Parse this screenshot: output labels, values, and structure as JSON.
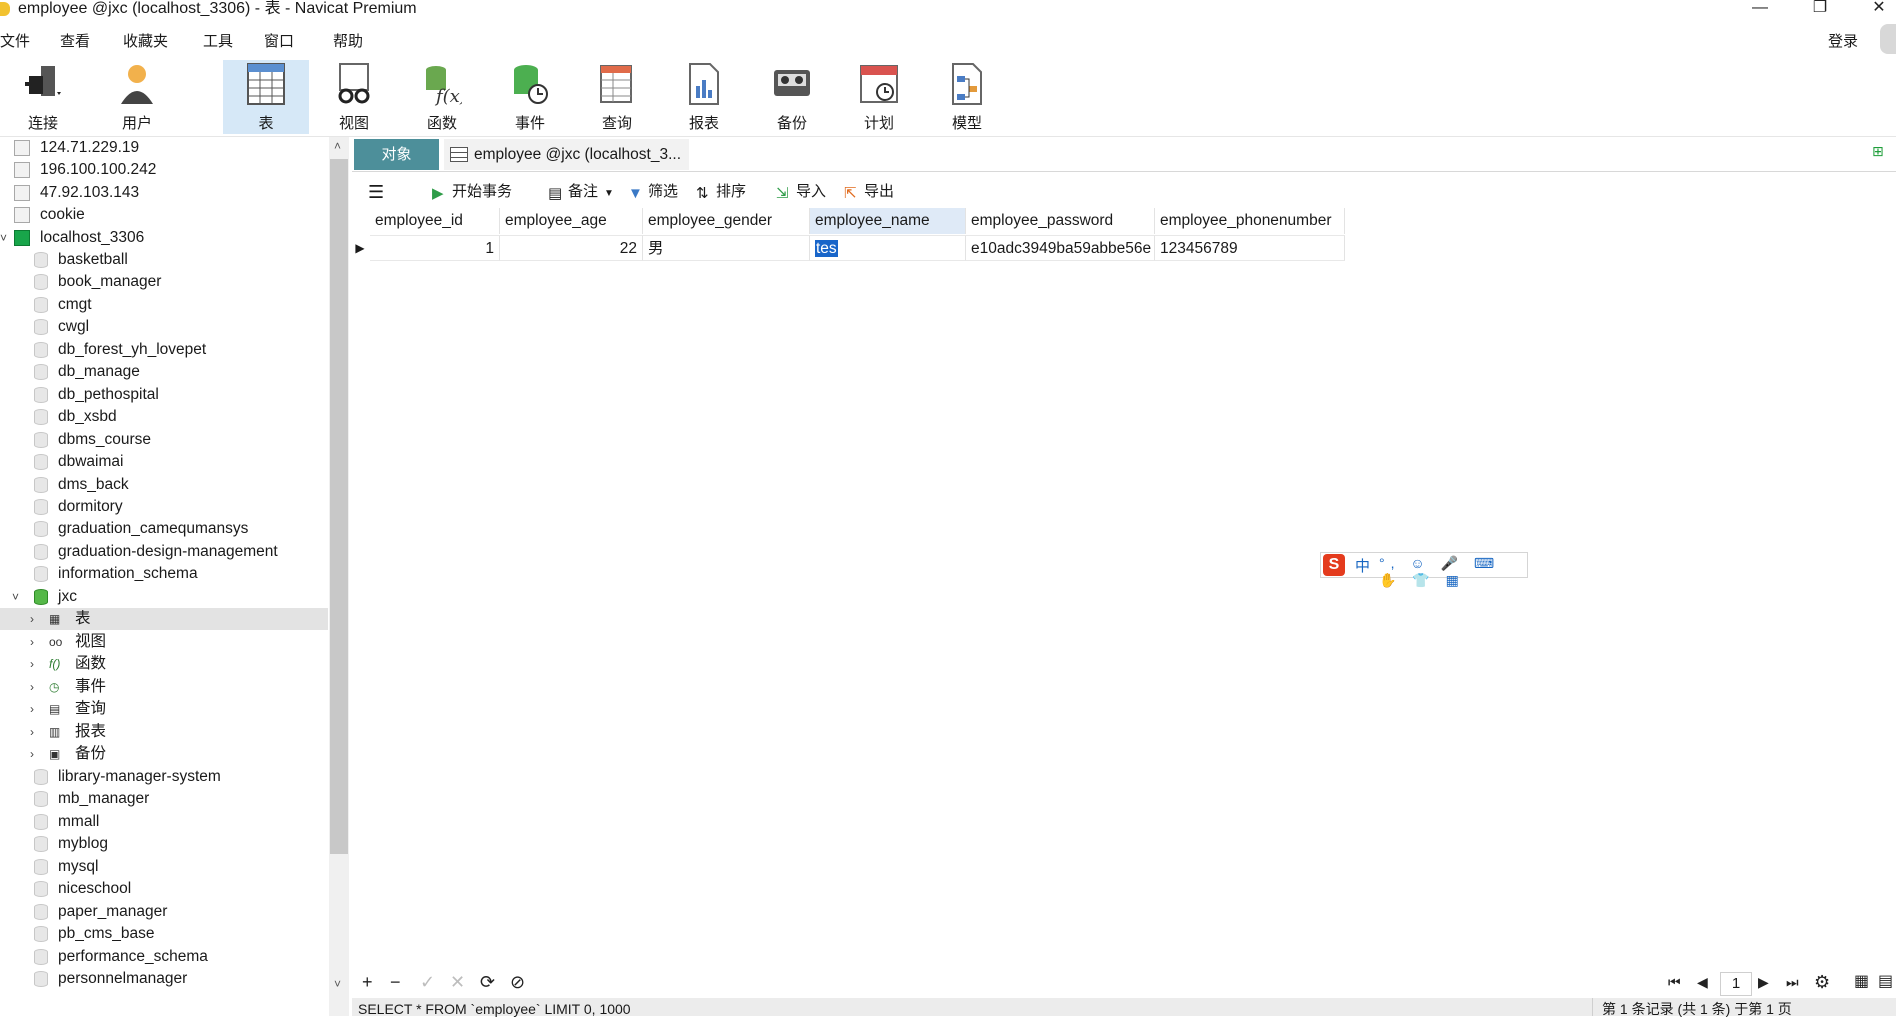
{
  "window": {
    "title": "employee @jxc (localhost_3306) - 表 - Navicat Premium",
    "minimize": "—",
    "restore": "❐",
    "close": "✕"
  },
  "menu": [
    "文件",
    "查看",
    "收藏夹",
    "工具",
    "窗口",
    "帮助"
  ],
  "login_label": "登录",
  "toolbar": [
    {
      "label": "连接",
      "icon": "plug-icon"
    },
    {
      "label": "用户",
      "icon": "user-icon"
    },
    {
      "label": "表",
      "icon": "table-icon",
      "active": true
    },
    {
      "label": "视图",
      "icon": "view-glasses-icon"
    },
    {
      "label": "函数",
      "icon": "function-icon"
    },
    {
      "label": "事件",
      "icon": "event-clock-icon"
    },
    {
      "label": "查询",
      "icon": "query-icon"
    },
    {
      "label": "报表",
      "icon": "report-icon"
    },
    {
      "label": "备份",
      "icon": "backup-icon"
    },
    {
      "label": "计划",
      "icon": "calendar-icon"
    },
    {
      "label": "模型",
      "icon": "model-icon"
    }
  ],
  "sidebar": {
    "connections_top": [
      "124.71.229.19",
      "196.100.100.242",
      "47.92.103.143",
      "cookie",
      "localhost_3306"
    ],
    "databases_before": [
      "basketball",
      "book_manager",
      "cmgt",
      "cwgl",
      "db_forest_yh_lovepet",
      "db_manage",
      "db_pethospital",
      "db_xsbd",
      "dbms_course",
      "dbwaimai",
      "dms_back",
      "dormitory",
      "graduation_camequmansys",
      "graduation-design-management",
      "information_schema"
    ],
    "open_db": "jxc",
    "open_db_children": [
      "表",
      "视图",
      "函数",
      "事件",
      "查询",
      "报表",
      "备份"
    ],
    "databases_after": [
      "library-manager-system",
      "mb_manager",
      "mmall",
      "myblog",
      "mysql",
      "niceschool",
      "paper_manager",
      "pb_cms_base",
      "performance_schema",
      "personnelmanager"
    ]
  },
  "tabs": {
    "objects": "对象",
    "employee": "employee @jxc (localhost_3..."
  },
  "subtoolbar": {
    "begin_tx": "开始事务",
    "memo": "备注",
    "filter": "筛选",
    "sort": "排序",
    "import": "导入",
    "export": "导出"
  },
  "grid": {
    "columns": [
      "employee_id",
      "employee_age",
      "employee_gender",
      "employee_name",
      "employee_password",
      "employee_phonenumber"
    ],
    "rows": [
      {
        "employee_id": "1",
        "employee_age": "22",
        "employee_gender": "男",
        "employee_name": "tes",
        "employee_password": "e10adc3949ba59abbe56e",
        "employee_phonenumber": "123456789"
      }
    ],
    "active_column": "employee_name"
  },
  "ime": {
    "logo": "S",
    "lang": "中",
    "tools": "°, ☺ 🎤 ⌨ ✋ 👕 ▦"
  },
  "bottom": {
    "add": "+",
    "remove": "−",
    "apply": "✓",
    "discard": "✕",
    "refresh": "⟳",
    "stop": "⊘",
    "first": "⏮",
    "prev": "◀",
    "page": "1",
    "next": "▶",
    "last": "⏭",
    "settings": "⚙"
  },
  "status": {
    "sql": "SELECT * FROM `employee` LIMIT 0, 1000",
    "records": "第 1 条记录 (共 1 条) 于第 1 页"
  }
}
